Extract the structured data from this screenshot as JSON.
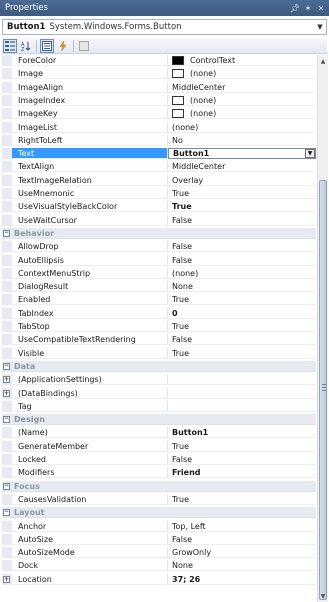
{
  "window": {
    "title": "Properties"
  },
  "object": {
    "name": "Button1",
    "type": "System.Windows.Forms.Button"
  },
  "toolbar": {
    "buttons": [
      {
        "name": "categorized-icon",
        "active": true
      },
      {
        "name": "alphabetical-icon",
        "active": false
      },
      {
        "name": "properties-icon",
        "active": true
      },
      {
        "name": "events-icon",
        "active": false
      },
      {
        "name": "property-pages-icon",
        "active": false
      }
    ]
  },
  "grid": {
    "rows": [
      {
        "kind": "prop",
        "name": "ForeColor",
        "value": "ControlText",
        "swatch": "black"
      },
      {
        "kind": "prop",
        "name": "Image",
        "value": "(none)",
        "swatch": "white"
      },
      {
        "kind": "prop",
        "name": "ImageAlign",
        "value": "MiddleCenter"
      },
      {
        "kind": "prop",
        "name": "ImageIndex",
        "value": "(none)",
        "swatch": "white"
      },
      {
        "kind": "prop",
        "name": "ImageKey",
        "value": "(none)",
        "swatch": "white"
      },
      {
        "kind": "prop",
        "name": "ImageList",
        "value": "(none)"
      },
      {
        "kind": "prop",
        "name": "RightToLeft",
        "value": "No"
      },
      {
        "kind": "prop",
        "name": "Text",
        "value": "Button1",
        "selected": true
      },
      {
        "kind": "prop",
        "name": "TextAlign",
        "value": "MiddleCenter"
      },
      {
        "kind": "prop",
        "name": "TextImageRelation",
        "value": "Overlay"
      },
      {
        "kind": "prop",
        "name": "UseMnemonic",
        "value": "True"
      },
      {
        "kind": "prop",
        "name": "UseVisualStyleBackColor",
        "value": "True",
        "bold": true
      },
      {
        "kind": "prop",
        "name": "UseWaitCursor",
        "value": "False"
      },
      {
        "kind": "cat",
        "name": "Behavior",
        "expanded": true
      },
      {
        "kind": "prop",
        "name": "AllowDrop",
        "value": "False"
      },
      {
        "kind": "prop",
        "name": "AutoEllipsis",
        "value": "False"
      },
      {
        "kind": "prop",
        "name": "ContextMenuStrip",
        "value": "(none)"
      },
      {
        "kind": "prop",
        "name": "DialogResult",
        "value": "None"
      },
      {
        "kind": "prop",
        "name": "Enabled",
        "value": "True"
      },
      {
        "kind": "prop",
        "name": "TabIndex",
        "value": "0",
        "bold": true
      },
      {
        "kind": "prop",
        "name": "TabStop",
        "value": "True"
      },
      {
        "kind": "prop",
        "name": "UseCompatibleTextRendering",
        "value": "False"
      },
      {
        "kind": "prop",
        "name": "Visible",
        "value": "True"
      },
      {
        "kind": "cat",
        "name": "Data",
        "expanded": true
      },
      {
        "kind": "prop",
        "name": "(ApplicationSettings)",
        "value": "",
        "expandable": true
      },
      {
        "kind": "prop",
        "name": "(DataBindings)",
        "value": "",
        "expandable": true
      },
      {
        "kind": "prop",
        "name": "Tag",
        "value": ""
      },
      {
        "kind": "cat",
        "name": "Design",
        "expanded": true
      },
      {
        "kind": "prop",
        "name": "(Name)",
        "value": "Button1",
        "bold": true
      },
      {
        "kind": "prop",
        "name": "GenerateMember",
        "value": "True"
      },
      {
        "kind": "prop",
        "name": "Locked",
        "value": "False"
      },
      {
        "kind": "prop",
        "name": "Modifiers",
        "value": "Friend",
        "bold": true
      },
      {
        "kind": "cat",
        "name": "Focus",
        "expanded": true
      },
      {
        "kind": "prop",
        "name": "CausesValidation",
        "value": "True"
      },
      {
        "kind": "cat",
        "name": "Layout",
        "expanded": true
      },
      {
        "kind": "prop",
        "name": "Anchor",
        "value": "Top, Left"
      },
      {
        "kind": "prop",
        "name": "AutoSize",
        "value": "False"
      },
      {
        "kind": "prop",
        "name": "AutoSizeMode",
        "value": "GrowOnly"
      },
      {
        "kind": "prop",
        "name": "Dock",
        "value": "None"
      },
      {
        "kind": "prop",
        "name": "Location",
        "value": "37; 26",
        "bold": true,
        "expandable": true
      }
    ]
  },
  "colors": {
    "titlebar": "#44628a",
    "selection": "#3399ff",
    "category_bg": "#e7ebf1",
    "category_text": "#8a96a6"
  }
}
